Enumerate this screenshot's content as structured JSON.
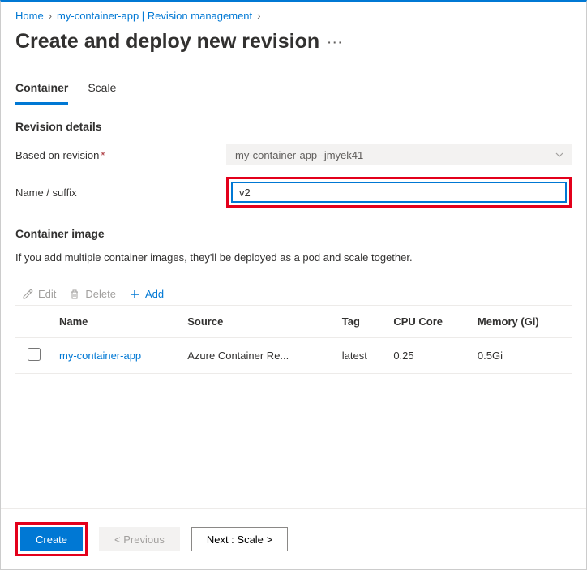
{
  "breadcrumb": {
    "home": "Home",
    "parent": "my-container-app | Revision management"
  },
  "page": {
    "title": "Create and deploy new revision",
    "more": "···"
  },
  "tabs": {
    "container": "Container",
    "scale": "Scale"
  },
  "revision_details": {
    "heading": "Revision details",
    "based_on_label": "Based on revision",
    "based_on_value": "my-container-app--jmyek41",
    "name_label": "Name / suffix",
    "name_value": "v2"
  },
  "container_image": {
    "heading": "Container image",
    "desc": "If you add multiple container images, they'll be deployed as a pod and scale together.",
    "toolbar": {
      "edit": "Edit",
      "delete": "Delete",
      "add": "Add"
    },
    "columns": {
      "name": "Name",
      "source": "Source",
      "tag": "Tag",
      "cpu": "CPU Core",
      "memory": "Memory (Gi)"
    },
    "rows": [
      {
        "name": "my-container-app",
        "source": "Azure Container Re...",
        "tag": "latest",
        "cpu": "0.25",
        "memory": "0.5Gi"
      }
    ]
  },
  "footer": {
    "create": "Create",
    "previous": "< Previous",
    "next": "Next : Scale >"
  }
}
